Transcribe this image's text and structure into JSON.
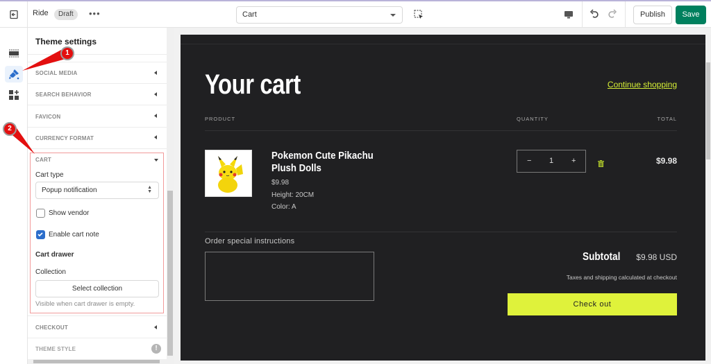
{
  "topbar": {
    "store_name": "Ride",
    "status_badge": "Draft",
    "more_label": "•••",
    "template_select": "Cart",
    "publish_label": "Publish",
    "save_label": "Save",
    "accent_color": "#00805e"
  },
  "rail": {
    "items": [
      {
        "name": "sections",
        "icon": "sections-icon"
      },
      {
        "name": "theme-settings",
        "icon": "paint-brush-icon",
        "active": true
      },
      {
        "name": "app-embeds",
        "icon": "apps-add-icon"
      }
    ]
  },
  "panel": {
    "title": "Theme settings",
    "sections": [
      {
        "label": "SOCIAL MEDIA",
        "state": "collapsed"
      },
      {
        "label": "SEARCH BEHAVIOR",
        "state": "collapsed"
      },
      {
        "label": "FAVICON",
        "state": "collapsed"
      },
      {
        "label": "CURRENCY FORMAT",
        "state": "collapsed"
      },
      {
        "label": "CART",
        "state": "expanded"
      },
      {
        "label": "CHECKOUT",
        "state": "collapsed"
      },
      {
        "label": "THEME STYLE",
        "state": "warning"
      }
    ],
    "cart": {
      "cart_type_label": "Cart type",
      "cart_type_value": "Popup notification",
      "show_vendor_label": "Show vendor",
      "show_vendor_checked": false,
      "enable_note_label": "Enable cart note",
      "enable_note_checked": true,
      "drawer_heading": "Cart drawer",
      "collection_label": "Collection",
      "select_collection_label": "Select collection",
      "collection_help": "Visible when cart drawer is empty."
    },
    "warning_glyph": "!"
  },
  "callouts": [
    "1",
    "2"
  ],
  "preview": {
    "title": "Your cart",
    "continue_label": "Continue shopping",
    "columns": {
      "product": "PRODUCT",
      "quantity": "QUANTITY",
      "total": "TOTAL"
    },
    "item": {
      "name": "Pokemon Cute Pikachu Plush Dolls",
      "price": "$9.98",
      "height": "Height: 20CM",
      "color": "Color: A",
      "quantity": "1",
      "minus": "−",
      "plus": "+",
      "total": "$9.98"
    },
    "instructions_label": "Order special instructions",
    "subtotal_label": "Subtotal",
    "subtotal_value": "$9.98 USD",
    "tax_note": "Taxes and shipping calculated at checkout",
    "checkout_label": "Check out",
    "accent_color": "#dff23b"
  }
}
